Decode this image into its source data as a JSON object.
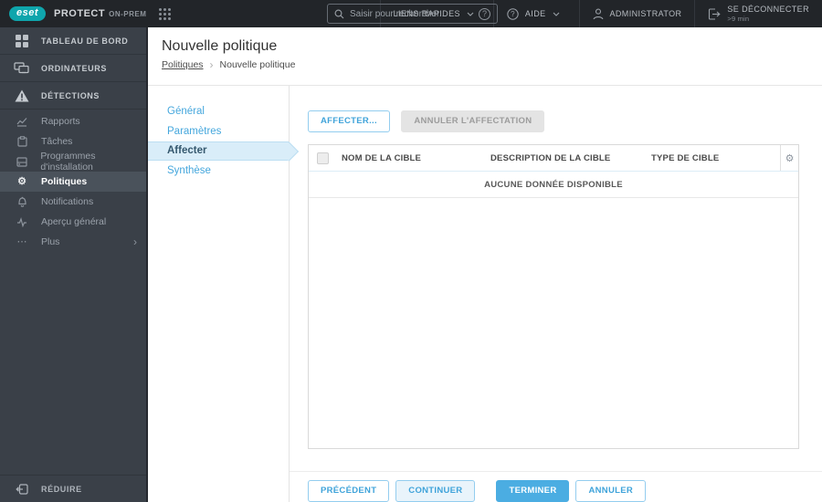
{
  "topbar": {
    "logo_text": "eset",
    "product": "PROTECT",
    "product_suffix": "ON-PREM",
    "search": {
      "placeholder": "Saisir pour rechercher..."
    },
    "quick_links_label": "LIENS RAPIDES",
    "help_label": "AIDE",
    "user_label": "ADMINISTRATOR",
    "logout_label": "SE DÉCONNECTER",
    "logout_timer": ">9 min"
  },
  "sidebar": {
    "primary": [
      {
        "label": "TABLEAU DE BORD",
        "icon": "dashboard-icon"
      },
      {
        "label": "ORDINATEURS",
        "icon": "computers-icon"
      },
      {
        "label": "DÉTECTIONS",
        "icon": "warning-triangle-icon"
      }
    ],
    "secondary": [
      {
        "label": "Rapports",
        "icon": "reports-chart-icon",
        "selected": false
      },
      {
        "label": "Tâches",
        "icon": "tasks-icon",
        "selected": false
      },
      {
        "label": "Programmes d'installation",
        "icon": "installers-icon",
        "selected": false
      },
      {
        "label": "Politiques",
        "icon": "gear-icon",
        "selected": true
      },
      {
        "label": "Notifications",
        "icon": "bell-icon",
        "selected": false
      },
      {
        "label": "Aperçu général",
        "icon": "status-overview-icon",
        "selected": false
      },
      {
        "label": "Plus",
        "icon": "ellipsis-icon",
        "selected": false
      }
    ],
    "collapse_label": "RÉDUIRE"
  },
  "header": {
    "title": "Nouvelle politique",
    "breadcrumb": {
      "parent": "Politiques",
      "current": "Nouvelle politique"
    }
  },
  "wizard": {
    "steps": [
      {
        "label": "Général",
        "active": false
      },
      {
        "label": "Paramètres",
        "active": false
      },
      {
        "label": "Affecter",
        "active": true
      },
      {
        "label": "Synthèse",
        "active": false
      }
    ]
  },
  "main": {
    "toolbar": {
      "assign_label": "AFFECTER...",
      "unassign_label": "ANNULER L'AFFECTATION",
      "unassign_disabled": true
    },
    "table": {
      "columns": [
        "NOM DE LA CIBLE",
        "DESCRIPTION DE LA CIBLE",
        "TYPE DE CIBLE"
      ],
      "rows": [],
      "empty_message": "AUCUNE DONNÉE DISPONIBLE"
    },
    "footer": {
      "previous_label": "PRÉCÉDENT",
      "continue_label": "CONTINUER",
      "finish_label": "TERMINER",
      "cancel_label": "ANNULER"
    }
  },
  "icons": {
    "gear": "⚙",
    "ellipsis": "⋯",
    "chevron_right": "›",
    "breadcrumb_separator": "›",
    "question_mark": "?"
  },
  "colors": {
    "brand_teal": "#0fa5ac",
    "topbar_bg": "#222529",
    "sidebar_bg": "#3a4048",
    "sidebar_selected_bg": "#4a525b",
    "accent_blue": "#45a7dd",
    "primary_button_bg": "#4bade2",
    "active_step_bg": "#d9edf9",
    "disabled_button_bg": "#e4e4e4"
  }
}
